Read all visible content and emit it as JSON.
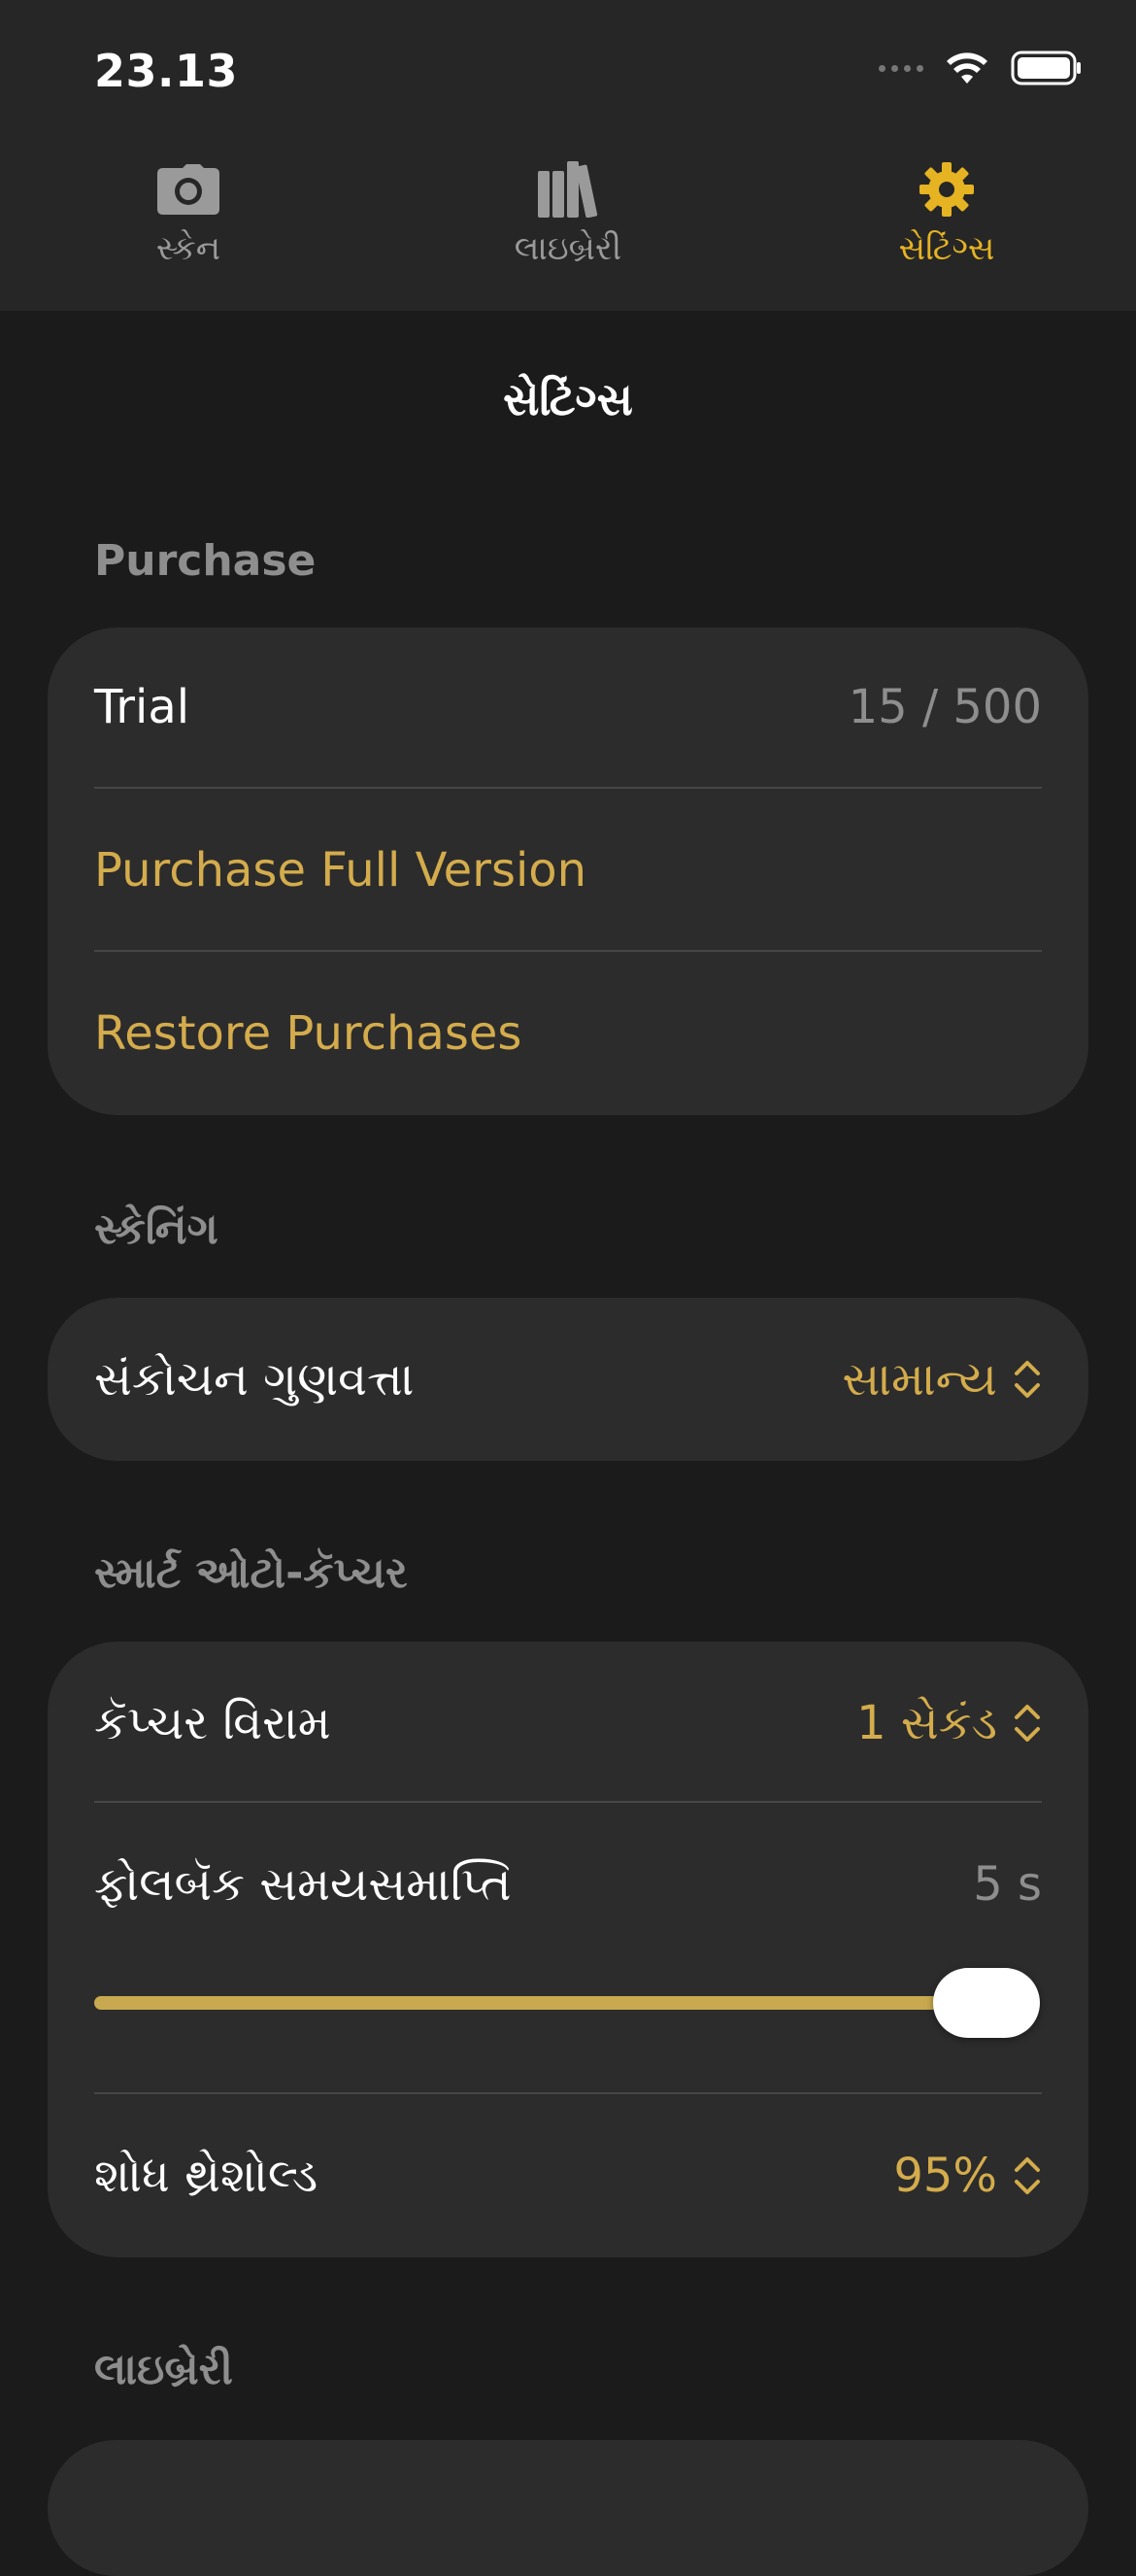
{
  "status_bar": {
    "time": "23.13"
  },
  "tabs": [
    {
      "label": "સ્કેન",
      "icon": "camera-icon",
      "active": false
    },
    {
      "label": "લાઇબ્રેરી",
      "icon": "library-books-icon",
      "active": false
    },
    {
      "label": "સેટિંગ્સ",
      "icon": "gear-icon",
      "active": true
    }
  ],
  "page_title": "સેટિંગ્સ",
  "purchase": {
    "header": "Purchase",
    "trial_label": "Trial",
    "trial_value": "15 / 500",
    "purchase_full_label": "Purchase Full Version",
    "restore_label": "Restore Purchases"
  },
  "scanning": {
    "header": "સ્કેનિંગ",
    "compression_label": "સંકોચન ગુણવત્તા",
    "compression_value": "સામાન્ય"
  },
  "auto_capture": {
    "header": "સ્માર્ટ ઓટો-કૅપ્ચર",
    "pause_label": "કૅપ્ચર વિરામ",
    "pause_value": "1 સેકંડ",
    "fallback_label": "ફોલબૅક સમયસમાપ્તિ",
    "fallback_value": "5 s",
    "fallback_slider_fraction": 1.0,
    "threshold_label": "શોધ થ્રેશોલ્ડ",
    "threshold_value": "95%"
  },
  "library": {
    "header": "લાઇબ્રેરી"
  },
  "colors": {
    "accent": "#e6b322",
    "gold_text": "#d4ac4c",
    "background": "#1b1b1b",
    "card": "#2c2c2c"
  }
}
